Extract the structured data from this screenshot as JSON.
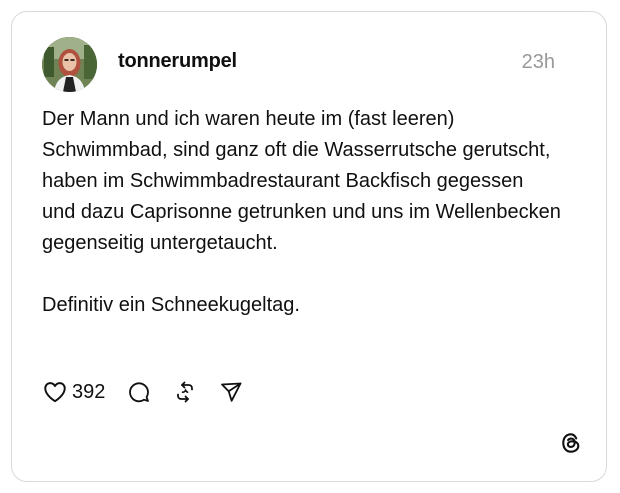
{
  "post": {
    "username": "tonnerumpel",
    "timestamp": "23h",
    "paragraphs": [
      "Der Mann und ich waren heute im (fast leeren) Schwimmbad, sind ganz oft die Wasserrutsche gerutscht, haben im Schwimmbadrestaurant Backfisch gegessen und dazu Caprisonne getrunken und uns im Wellenbecken gegenseitig untergetaucht.",
      "Definitiv ein Schneekugeltag."
    ],
    "like_count": "392"
  },
  "icons": {
    "like": "heart-icon",
    "comment": "comment-icon",
    "repost": "repost-icon",
    "share": "share-icon",
    "brand": "threads-logo-icon"
  },
  "colors": {
    "text": "#101010",
    "muted": "#999999",
    "border": "#d9d9d9"
  }
}
